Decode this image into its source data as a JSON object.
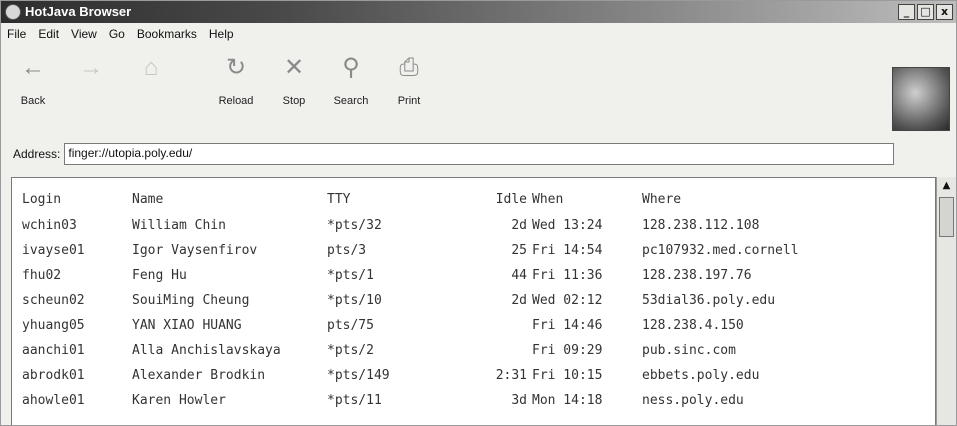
{
  "window": {
    "title": "HotJava Browser"
  },
  "window_controls": {
    "minimize": "_",
    "maximize": "□",
    "close": "x"
  },
  "menu": [
    "File",
    "Edit",
    "View",
    "Go",
    "Bookmarks",
    "Help"
  ],
  "toolbar": [
    {
      "label": "Back",
      "icon": "back-arrow-icon",
      "glyph": "←",
      "enabled": true
    },
    {
      "label": "",
      "icon": "forward-arrow-icon",
      "glyph": "→",
      "enabled": false
    },
    {
      "label": "",
      "icon": "home-icon",
      "glyph": "⌂",
      "enabled": false
    },
    {
      "label": "Reload",
      "icon": "reload-icon",
      "glyph": "↻",
      "enabled": true
    },
    {
      "label": "Stop",
      "icon": "stop-icon",
      "glyph": "✕",
      "enabled": true
    },
    {
      "label": "Search",
      "icon": "search-icon",
      "glyph": "⚲",
      "enabled": true
    },
    {
      "label": "Print",
      "icon": "print-icon",
      "glyph": "⎙",
      "enabled": true
    }
  ],
  "address": {
    "label": "Address:",
    "value": "finger://utopia.poly.edu/"
  },
  "finger": {
    "headers": [
      "Login",
      "Name",
      "TTY",
      "Idle",
      "When",
      "Where"
    ],
    "rows": [
      [
        "wchin03",
        "William Chin",
        "*pts/32",
        "2d",
        "Wed 13:24",
        "128.238.112.108"
      ],
      [
        "ivayse01",
        "Igor Vaysenfirov",
        "pts/3",
        "25",
        "Fri 14:54",
        "pc107932.med.cornell"
      ],
      [
        "fhu02",
        "Feng Hu",
        "*pts/1",
        "44",
        "Fri 11:36",
        "128.238.197.76"
      ],
      [
        "scheun02",
        "SouiMing Cheung",
        "*pts/10",
        "2d",
        "Wed 02:12",
        "53dial36.poly.edu"
      ],
      [
        "yhuang05",
        "YAN XIAO HUANG",
        "pts/75",
        "",
        "Fri 14:46",
        "128.238.4.150"
      ],
      [
        "aanchi01",
        "Alla Anchislavskaya",
        "*pts/2",
        "",
        "Fri 09:29",
        "pub.sinc.com"
      ],
      [
        "abrodk01",
        "Alexander Brodkin",
        "*pts/149",
        "2:31",
        "Fri 10:15",
        "ebbets.poly.edu"
      ],
      [
        "ahowle01",
        "Karen Howler",
        "*pts/11",
        "3d",
        "Mon 14:18",
        "ness.poly.edu"
      ]
    ]
  }
}
